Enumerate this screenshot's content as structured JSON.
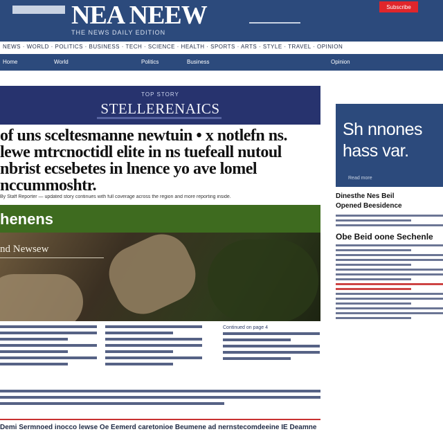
{
  "masthead": {
    "logo": "NEA NEEW",
    "tagline": "THE NEWS DAILY EDITION",
    "subscribe_label": "Subscribe"
  },
  "dateline": "NEWS · WORLD · POLITICS · BUSINESS · TECH · SCIENCE · HEALTH · SPORTS · ARTS · STYLE · TRAVEL · OPINION",
  "nav": {
    "items": [
      "Home",
      "World",
      "Politics",
      "Business",
      "Opinion"
    ]
  },
  "section_banner": {
    "kicker": "TOP STORY",
    "name": "STELLERENAICS"
  },
  "headline": "of uns sceltesmanne newtuin • x notlefn ns. lewe mtrcnoctidl elite in ns tuefeall nutoul nbrist ecsebetes in lnence yo ave lomel nccummoshtr.",
  "standfirst": "By Staff Reporter — updated story continues with full coverage across the region and more reporting inside.",
  "photo": {
    "band_title": "henens",
    "overlay_title": "nd Newsew"
  },
  "column_kicker": "Continued on page 4",
  "bottom_headline": "Demi Sermnoed inocco lewse Oe Eemerd caretonioe Beumene ad nernstecomdeeine IE Deamne",
  "sidebar": {
    "box_title": "Sh nnones hass var.",
    "box_footer": "Read more",
    "items": [
      {
        "title": "Dinesthe Nes Beil",
        "featured": false
      },
      {
        "title": "Opened Beesidence",
        "featured": false
      },
      {
        "title": "Obe Beid oone Sechenle",
        "featured": true
      }
    ]
  }
}
